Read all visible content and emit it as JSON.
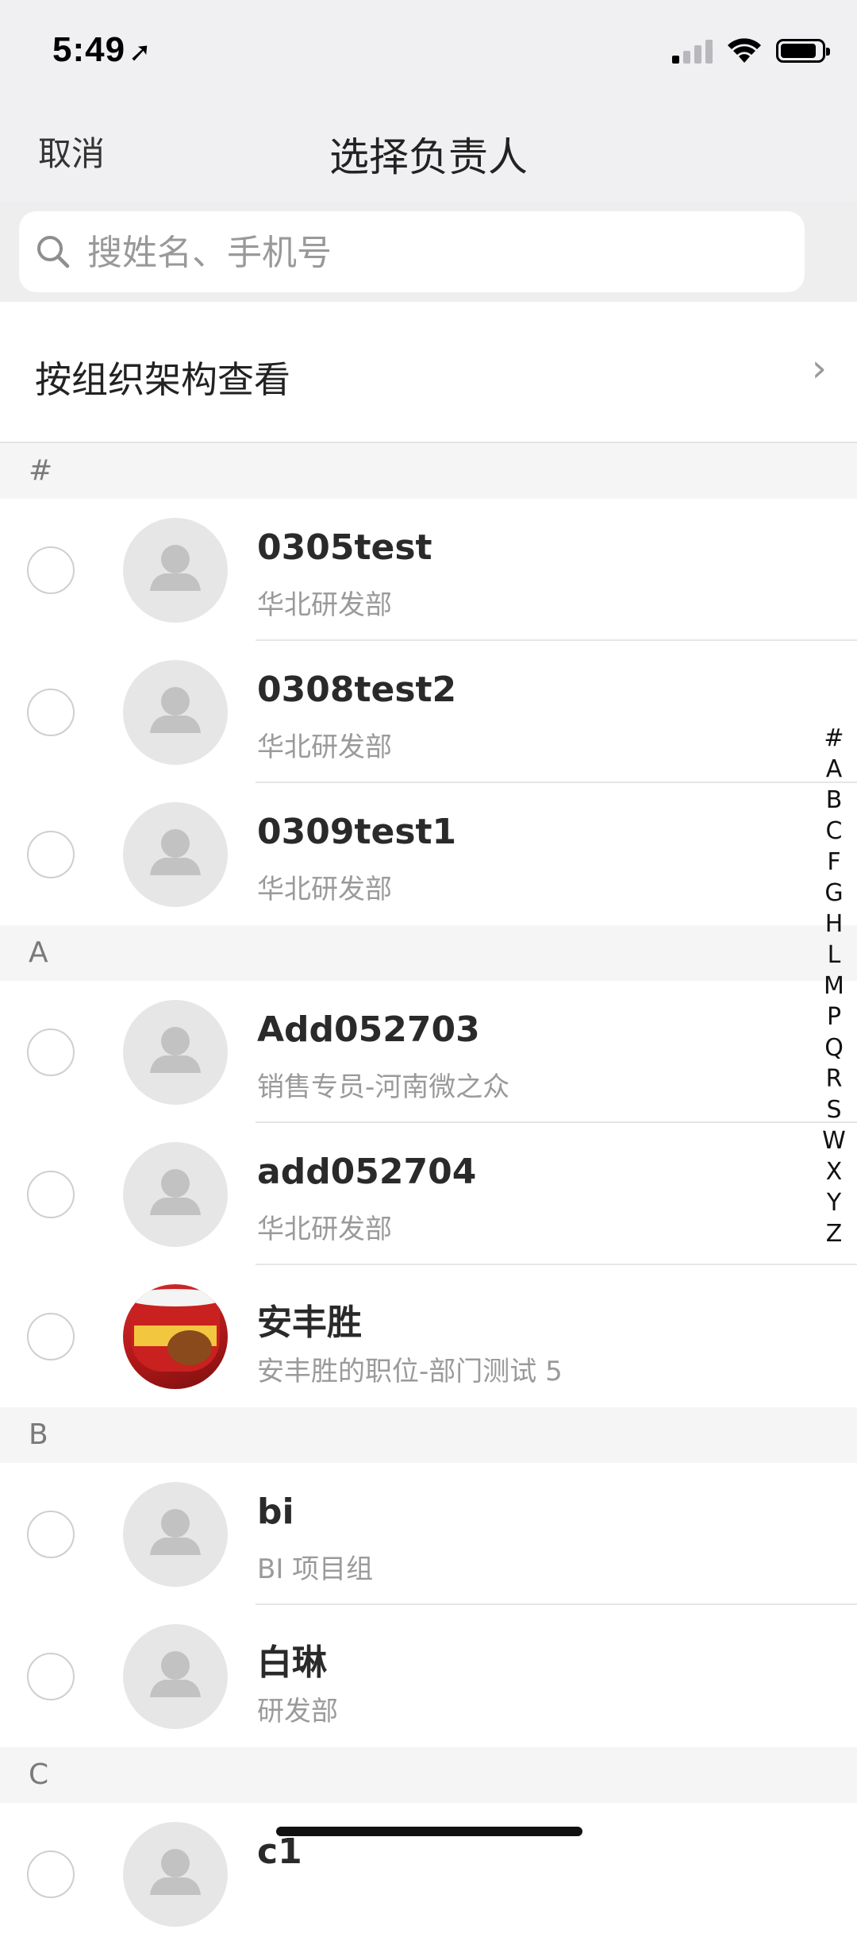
{
  "status_bar": {
    "time": "5:49",
    "location_icon": "location-arrow-icon",
    "signal_icon": "cellular-signal-icon",
    "wifi_icon": "wifi-icon",
    "battery_icon": "battery-icon"
  },
  "nav": {
    "cancel_label": "取消",
    "title": "选择负责人"
  },
  "search": {
    "placeholder": "搜姓名、手机号",
    "icon": "search-icon"
  },
  "org_browse": {
    "label": "按组织架构查看",
    "chevron": "›"
  },
  "sections": [
    {
      "letter": "#",
      "contacts": [
        {
          "name": "0305test",
          "dept": "华北研发部"
        },
        {
          "name": "0308test2",
          "dept": "华北研发部"
        },
        {
          "name": "0309test1",
          "dept": "华北研发部"
        }
      ]
    },
    {
      "letter": "A",
      "contacts": [
        {
          "name": "Add052703",
          "dept": "销售专员-河南微之众"
        },
        {
          "name": "add052704",
          "dept": "华北研发部"
        },
        {
          "name": "安丰胜",
          "dept": "安丰胜的职位-部门测试 5",
          "photo": true
        }
      ]
    },
    {
      "letter": "B",
      "contacts": [
        {
          "name": "bi",
          "dept": "BI 项目组"
        },
        {
          "name": "白琳",
          "dept": "研发部"
        }
      ]
    },
    {
      "letter": "C",
      "contacts": [
        {
          "name": "c1",
          "dept": ""
        }
      ]
    }
  ],
  "index_letters": [
    "#",
    "A",
    "B",
    "C",
    "F",
    "G",
    "H",
    "L",
    "M",
    "P",
    "Q",
    "R",
    "S",
    "W",
    "X",
    "Y",
    "Z"
  ],
  "colors": {
    "background_bar": "#f0f0f2",
    "section_header_bg": "#f5f5f5",
    "avatar_placeholder": "#e6e6e6",
    "secondary_text": "#9a9a9a"
  }
}
